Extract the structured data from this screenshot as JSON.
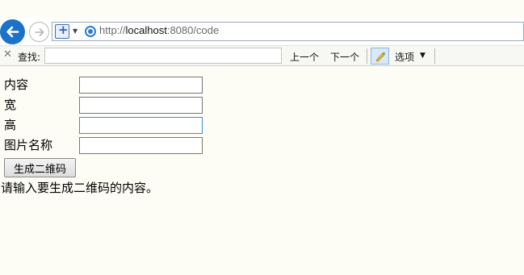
{
  "browser": {
    "url_prefix": "http://",
    "url_host": "localhost",
    "url_rest": ":8080/code"
  },
  "find_bar": {
    "label": "查找:",
    "value": "",
    "prev_label": "上一个",
    "next_label": "下一个",
    "options_label": "选项"
  },
  "form": {
    "content_label": "内容",
    "width_label": "宽",
    "height_label": "高",
    "image_name_label": "图片名称",
    "content_value": "",
    "width_value": "",
    "height_value": "",
    "image_name_value": "",
    "submit_label": "生成二维码",
    "hint": "请输入要生成二维码的内容。"
  }
}
